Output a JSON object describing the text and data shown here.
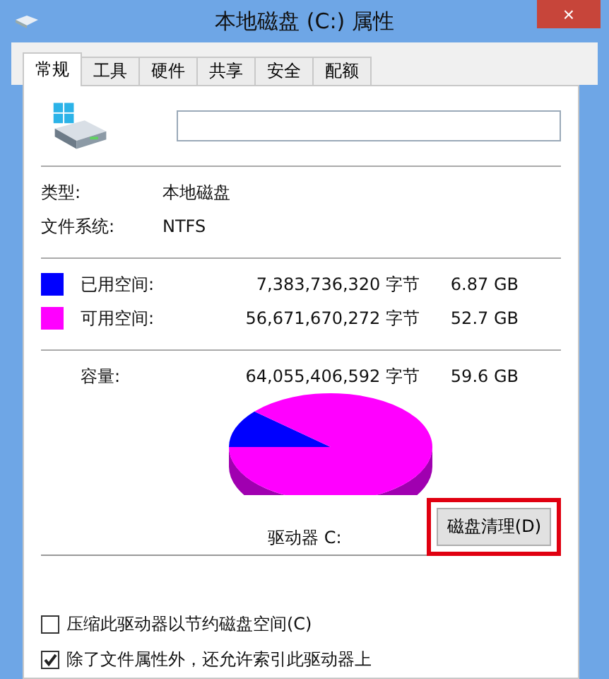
{
  "window": {
    "title": "本地磁盘 (C:) 属性",
    "close": "×"
  },
  "tabs": [
    {
      "label": "常规",
      "selected": true
    },
    {
      "label": "工具",
      "selected": false
    },
    {
      "label": "硬件",
      "selected": false
    },
    {
      "label": "共享",
      "selected": false
    },
    {
      "label": "安全",
      "selected": false
    },
    {
      "label": "配额",
      "selected": false
    }
  ],
  "info": [
    {
      "label": "类型:",
      "value": "本地磁盘"
    },
    {
      "label": "文件系统:",
      "value": "NTFS"
    }
  ],
  "space": [
    {
      "label": "已用空间:",
      "bytes": "7,383,736,320 字节",
      "size": "6.87 GB",
      "color": "#0000ff"
    },
    {
      "label": "可用空间:",
      "bytes": "56,671,670,272 字节",
      "size": "52.7 GB",
      "color": "#ff00ff"
    }
  ],
  "capacity": {
    "label": "容量:",
    "bytes": "64,055,406,592 字节",
    "size": "59.6 GB"
  },
  "drive_label": "驱动器 C:",
  "cleanup_button": {
    "label": "磁盘清理(D)",
    "highlighted": true
  },
  "options": [
    {
      "label": "压缩此驱动器以节约磁盘空间(C)",
      "checked": false
    },
    {
      "label": "除了文件属性外，还允许索引此驱动器上",
      "checked": true
    }
  ]
}
